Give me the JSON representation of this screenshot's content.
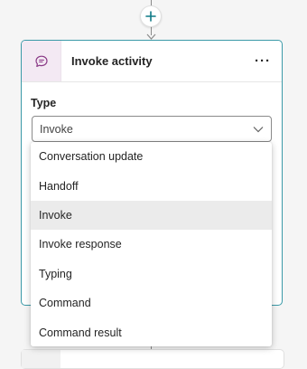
{
  "canvas": {
    "add_step_icon": "plus-icon"
  },
  "card": {
    "icon": "chat-bubble-icon",
    "title": "Invoke activity",
    "more_label": "···",
    "type_label": "Type",
    "select": {
      "value": "Invoke",
      "icon": "chevron-down-icon"
    }
  },
  "dropdown": {
    "options": [
      {
        "label": "Conversation update"
      },
      {
        "label": "Handoff"
      },
      {
        "label": "Invoke",
        "selected": true
      },
      {
        "label": "Invoke response"
      },
      {
        "label": "Typing"
      },
      {
        "label": "Command"
      },
      {
        "label": "Command result"
      }
    ]
  },
  "colors": {
    "card_border": "#3b9aa8",
    "add_icon": "#0f7a86",
    "header_icon_bg": "#f3e9f3",
    "header_icon": "#8a3a86",
    "selected_option_bg": "#ebebeb"
  }
}
